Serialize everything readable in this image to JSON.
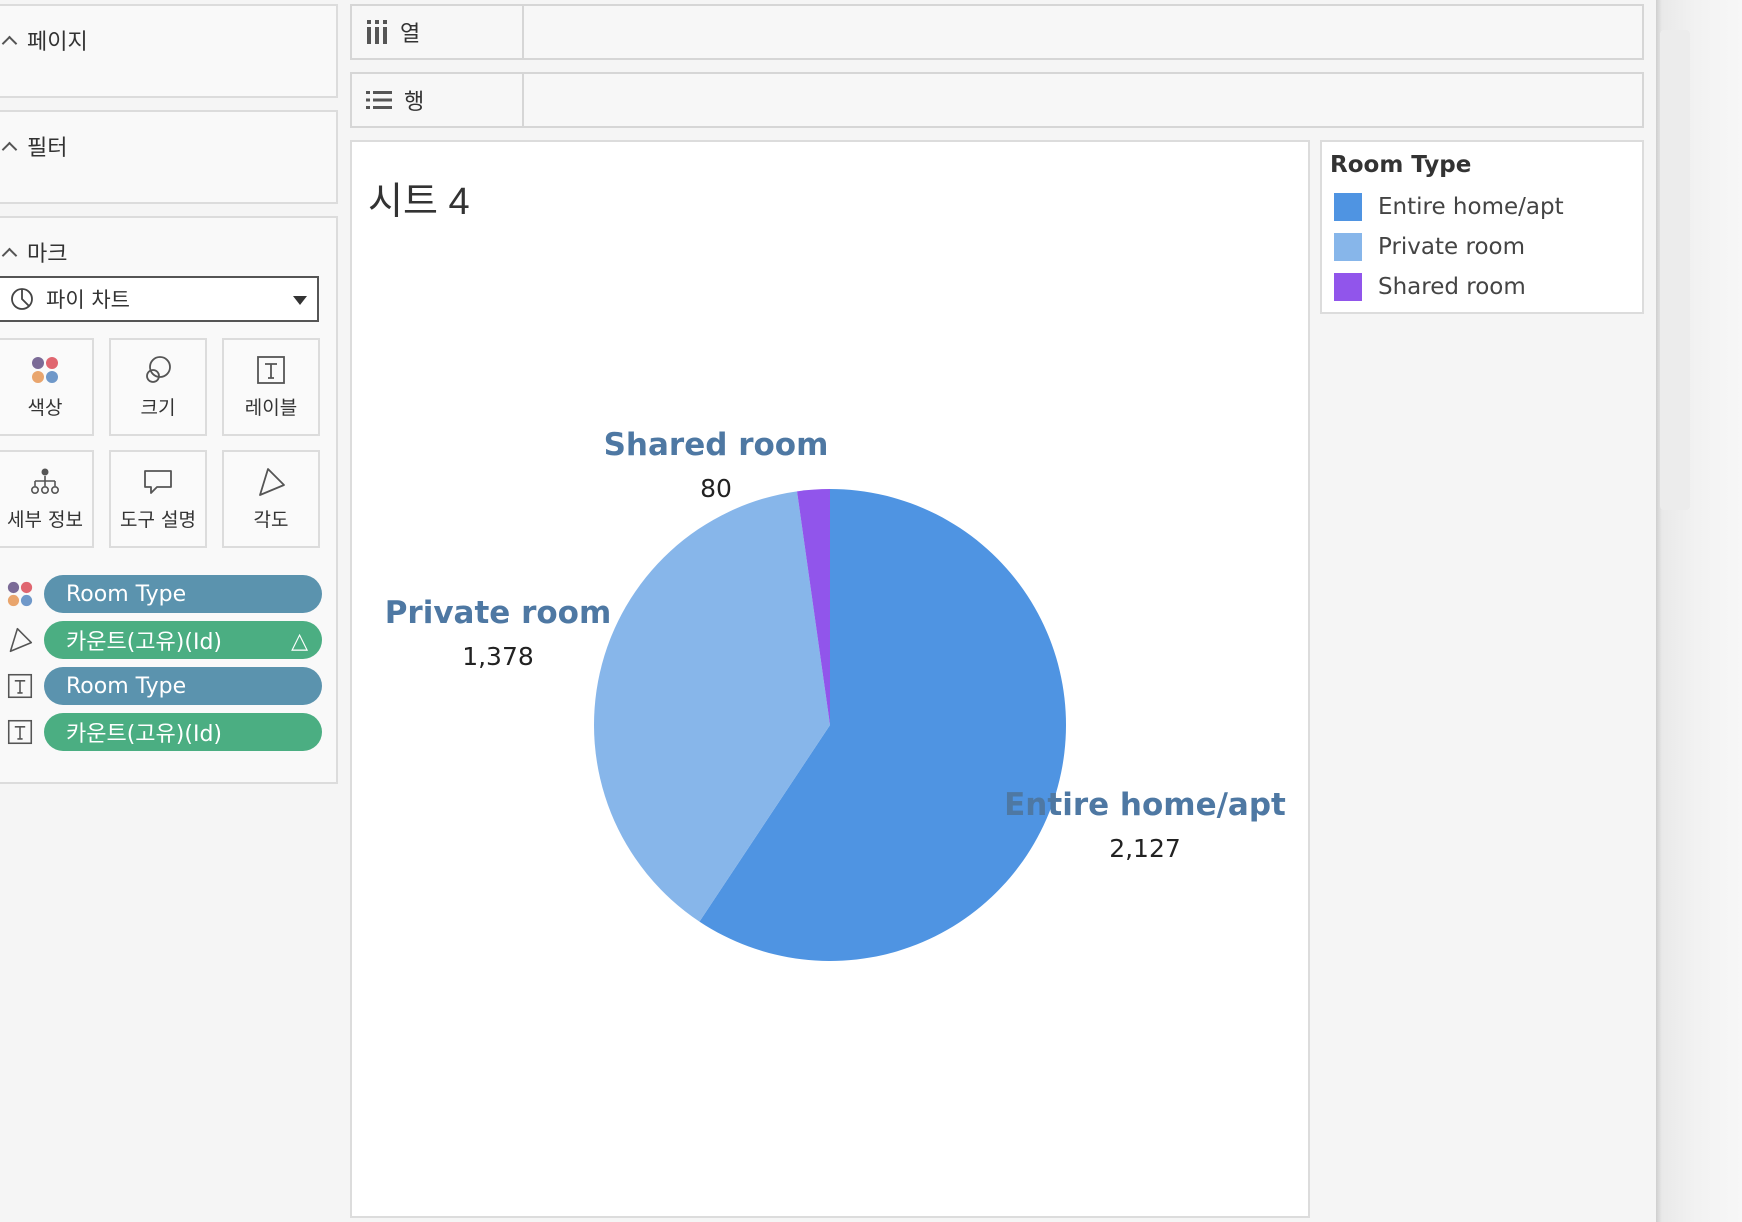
{
  "sidebar": {
    "pages": {
      "title": "페이지"
    },
    "filters": {
      "title": "필터"
    },
    "marks": {
      "title": "마크",
      "mark_type": "파이 차트",
      "buttons": [
        {
          "label": "색상",
          "icon": "color-icon"
        },
        {
          "label": "크기",
          "icon": "size-icon"
        },
        {
          "label": "레이블",
          "icon": "label-icon"
        },
        {
          "label": "세부 정보",
          "icon": "detail-icon"
        },
        {
          "label": "도구 설명",
          "icon": "tooltip-icon"
        },
        {
          "label": "각도",
          "icon": "angle-icon"
        }
      ],
      "pills": [
        {
          "label": "Room Type",
          "kind": "dimension",
          "icon": "color-icon"
        },
        {
          "label": "카운트(고유)(Id)",
          "kind": "measure",
          "icon": "angle-icon",
          "extra": "△"
        },
        {
          "label": "Room Type",
          "kind": "dimension",
          "icon": "label-icon"
        },
        {
          "label": "카운트(고유)(Id)",
          "kind": "measure",
          "icon": "label-icon"
        }
      ]
    }
  },
  "shelves": {
    "columns": {
      "label": "열",
      "icon": "columns-icon"
    },
    "rows": {
      "label": "행",
      "icon": "rows-icon"
    }
  },
  "sheet": {
    "title": "시트 4"
  },
  "legend": {
    "title": "Room Type",
    "items": [
      {
        "label": "Entire home/apt",
        "color": "#4f94e2"
      },
      {
        "label": "Private room",
        "color": "#87b6ea"
      },
      {
        "label": "Shared room",
        "color": "#9155eb"
      }
    ]
  },
  "chart_data": {
    "type": "pie",
    "title": "시트 4",
    "slices": [
      {
        "label": "Entire home/apt",
        "value": 2127,
        "value_label": "2,127",
        "color": "#4f94e2"
      },
      {
        "label": "Private room",
        "value": 1378,
        "value_label": "1,378",
        "color": "#87b6ea"
      },
      {
        "label": "Shared room",
        "value": 80,
        "value_label": "80",
        "color": "#9155eb"
      }
    ],
    "label_color": "#4e78a3",
    "value_color": "#222222"
  }
}
